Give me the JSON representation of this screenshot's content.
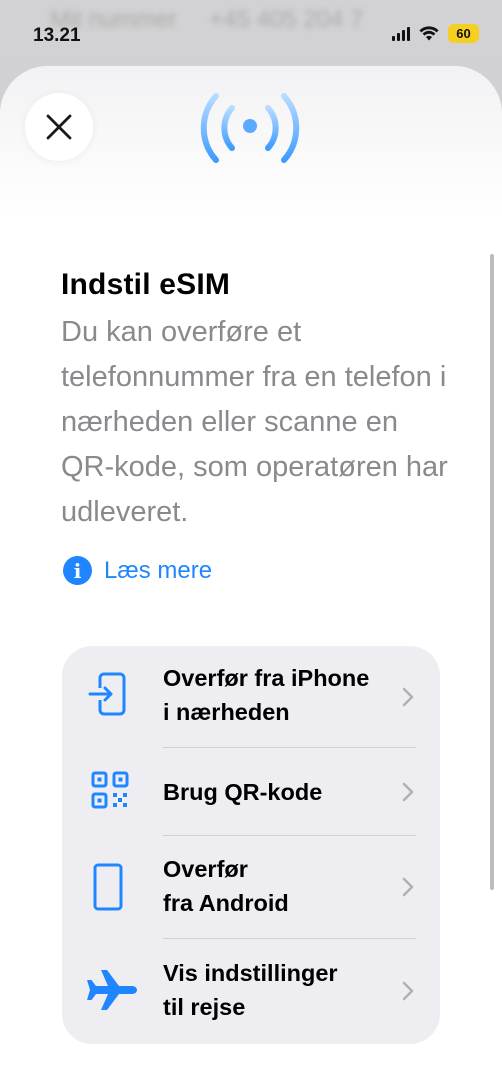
{
  "status_bar": {
    "time": "13.21",
    "battery": "60",
    "background_text": [
      "Mit nummer",
      "+45 405 204 7"
    ]
  },
  "sheet": {
    "close_icon": "close-icon",
    "header_icon": "antenna-signal-icon",
    "title": "Indstil eSIM",
    "description": "Du kan overføre et telefonnummer fra en telefon i nærheden eller scanne en QR-kode, som operatøren har udleveret.",
    "learn_more": "Læs mere",
    "options": [
      {
        "line1": "Overfør fra iPhone",
        "line2": "i nærheden",
        "icon": "transfer-phone-icon"
      },
      {
        "line1": "Brug QR-kode",
        "line2": "",
        "icon": "qr-code-icon"
      },
      {
        "line1": "Overfør",
        "line2": "fra Android",
        "icon": "android-phone-icon"
      },
      {
        "line1": "Vis indstillinger",
        "line2": "til rejse",
        "icon": "airplane-icon"
      }
    ]
  },
  "colors": {
    "accent": "#1f86ff",
    "secondary_text": "#8a8a8e",
    "card_bg": "#eeeef2",
    "battery": "#f5d020"
  }
}
